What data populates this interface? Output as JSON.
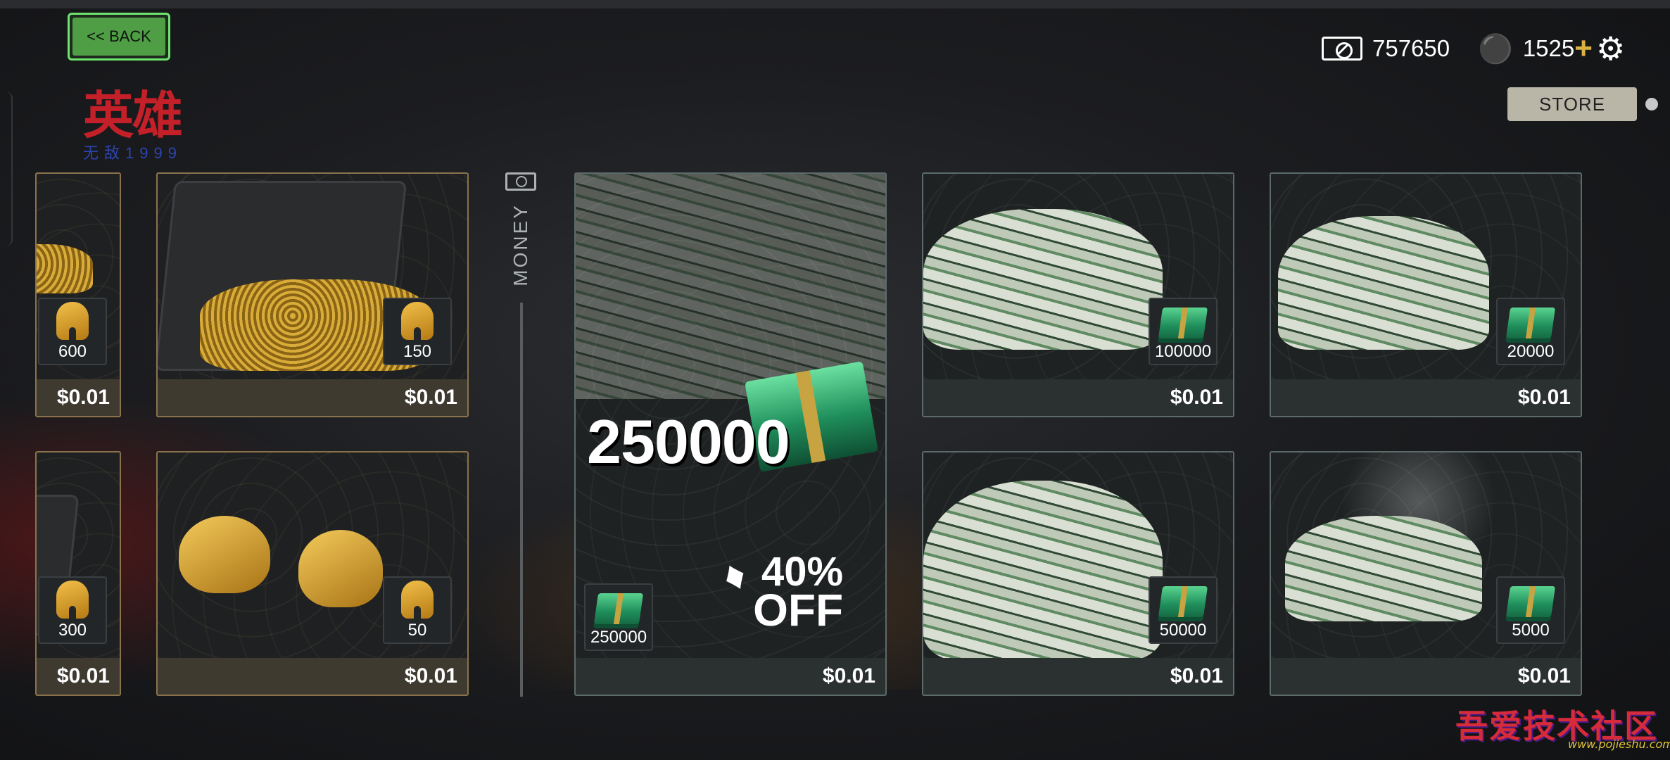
{
  "header": {
    "back_label": "<< BACK",
    "logo_main": "英雄",
    "logo_sub": "无敌1999",
    "cash_balance": "757650",
    "teeth_balance": "1525",
    "store_label": "STORE"
  },
  "section_label": "MONEY",
  "items": [
    {
      "id": "gold-600",
      "type": "teeth",
      "qty": "600",
      "price": "$0.01"
    },
    {
      "id": "gold-150",
      "type": "teeth",
      "qty": "150",
      "price": "$0.01"
    },
    {
      "id": "gold-300",
      "type": "teeth",
      "qty": "300",
      "price": "$0.01"
    },
    {
      "id": "gold-50",
      "type": "teeth",
      "qty": "50",
      "price": "$0.01"
    },
    {
      "id": "cash-250000",
      "type": "cash",
      "qty": "250000",
      "headline": "250000",
      "discount_pct": "40%",
      "discount_word": "OFF",
      "price": "$0.01"
    },
    {
      "id": "cash-100000",
      "type": "cash",
      "qty": "100000",
      "price": "$0.01"
    },
    {
      "id": "cash-20000",
      "type": "cash",
      "qty": "20000",
      "price": "$0.01"
    },
    {
      "id": "cash-50000",
      "type": "cash",
      "qty": "50000",
      "price": "$0.01"
    },
    {
      "id": "cash-5000",
      "type": "cash",
      "qty": "5000",
      "price": "$0.01"
    }
  ],
  "watermark": {
    "main": "吾爱技术社区",
    "url": "www.pojieshu.com"
  },
  "colors": {
    "back_border": "#6ee36e",
    "back_fill": "#4f9e45",
    "gold_border": "#8a734c",
    "money_border": "#5c6a6a",
    "store_bg": "#b9b6a8"
  }
}
